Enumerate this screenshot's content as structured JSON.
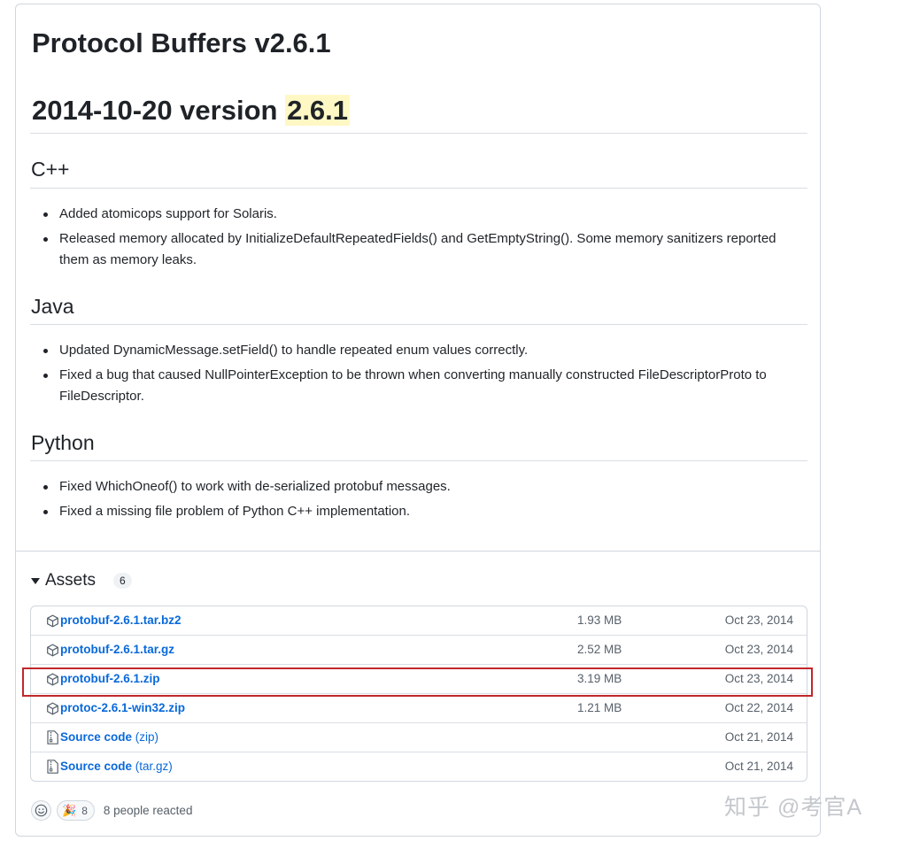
{
  "release": {
    "title": "Protocol Buffers v2.6.1",
    "version_heading_prefix": "2014-10-20 version ",
    "version_highlight": "2.6.1"
  },
  "sections": [
    {
      "heading": "C++",
      "items": [
        "Added atomicops support for Solaris.",
        "Released memory allocated by InitializeDefaultRepeatedFields() and GetEmptyString(). Some memory sanitizers reported them as memory leaks."
      ]
    },
    {
      "heading": "Java",
      "items": [
        "Updated DynamicMessage.setField() to handle repeated enum values correctly.",
        "Fixed a bug that caused NullPointerException to be thrown when converting manually constructed FileDescriptorProto to FileDescriptor."
      ]
    },
    {
      "heading": "Python",
      "items": [
        "Fixed WhichOneof() to work with de-serialized protobuf messages.",
        "Fixed a missing file problem of Python C++ implementation."
      ]
    }
  ],
  "assets": {
    "title": "Assets",
    "count": "6",
    "items": [
      {
        "icon": "package-icon",
        "name": "protobuf-2.6.1.tar.bz2",
        "sub": "",
        "size": "1.93 MB",
        "date": "Oct 23, 2014"
      },
      {
        "icon": "package-icon",
        "name": "protobuf-2.6.1.tar.gz",
        "sub": "",
        "size": "2.52 MB",
        "date": "Oct 23, 2014"
      },
      {
        "icon": "package-icon",
        "name": "protobuf-2.6.1.zip",
        "sub": "",
        "size": "3.19 MB",
        "date": "Oct 23, 2014"
      },
      {
        "icon": "package-icon",
        "name": "protoc-2.6.1-win32.zip",
        "sub": "",
        "size": "1.21 MB",
        "date": "Oct 22, 2014"
      },
      {
        "icon": "file-zip-icon",
        "name": "Source code",
        "sub": " (zip)",
        "size": "",
        "date": "Oct 21, 2014"
      },
      {
        "icon": "file-zip-icon",
        "name": "Source code",
        "sub": " (tar.gz)",
        "size": "",
        "date": "Oct 21, 2014"
      }
    ]
  },
  "reactions": {
    "emoji": "🎉",
    "count": "8",
    "summary": "8 people reacted"
  },
  "watermark": "知乎 @考官A",
  "colors": {
    "link": "#0969da",
    "highlight_box": "#c0282c",
    "mark": "#fff8c5"
  }
}
